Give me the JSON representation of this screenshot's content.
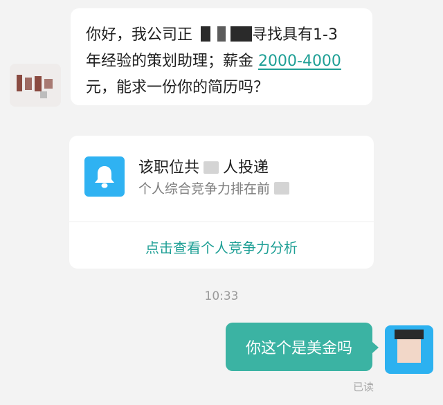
{
  "incoming_message": {
    "line1_before_mask": "你好，我公司正",
    "line1_after_mask": "寻找具有1-3",
    "line2_before_link": "年经验的策划助理；薪金",
    "salary_link": "2000-4000",
    "line3": "元，能求一份你的简历吗？"
  },
  "job_card": {
    "icon": "bell-icon",
    "title_before": "该职位共",
    "title_after": "人投递",
    "subtitle": "个人综合竞争力排在前",
    "action_link": "点击查看个人竞争力分析"
  },
  "timestamp": "10:33",
  "outgoing_message": {
    "text": "你这个是美金吗",
    "status": "已读"
  },
  "colors": {
    "accent": "#1e9f95",
    "outgoing_bubble": "#3bb3a3",
    "bell_tile": "#2fb2f2"
  }
}
